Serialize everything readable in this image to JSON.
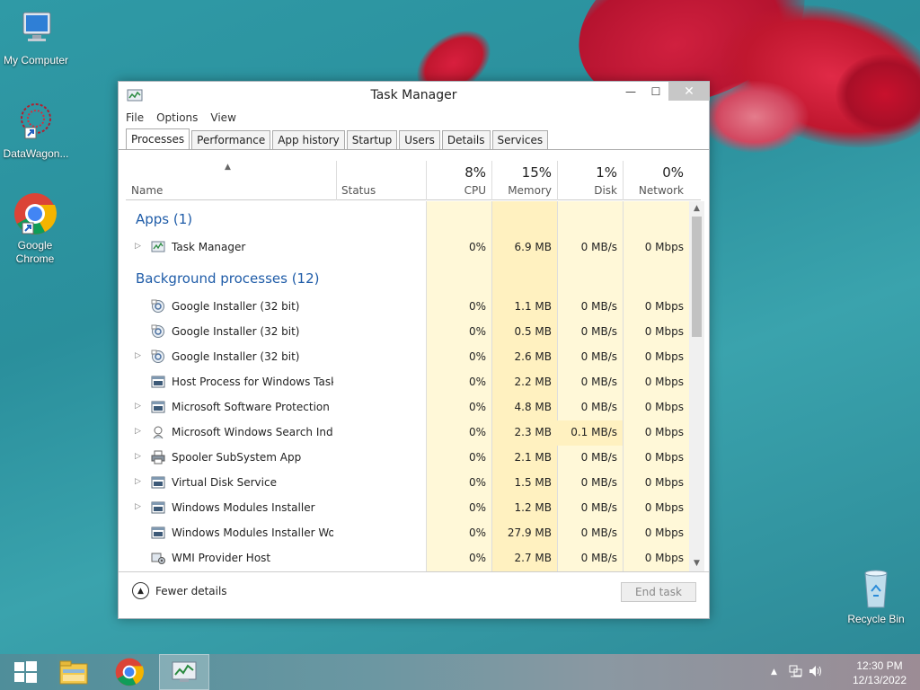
{
  "desktop": {
    "icons": [
      {
        "label": "My Computer"
      },
      {
        "label": "DataWagon..."
      },
      {
        "label": "Google Chrome"
      },
      {
        "label": "Recycle Bin"
      }
    ]
  },
  "window": {
    "title": "Task Manager",
    "controls": {
      "minimize": "—",
      "maximize": "☐",
      "close": "✕"
    },
    "menu": [
      "File",
      "Options",
      "View"
    ],
    "tabs": [
      "Processes",
      "Performance",
      "App history",
      "Startup",
      "Users",
      "Details",
      "Services"
    ],
    "active_tab": "Processes",
    "columns": {
      "name": "Name",
      "status": "Status",
      "cpu": {
        "pct": "8%",
        "label": "CPU"
      },
      "memory": {
        "pct": "15%",
        "label": "Memory"
      },
      "disk": {
        "pct": "1%",
        "label": "Disk"
      },
      "network": {
        "pct": "0%",
        "label": "Network"
      }
    },
    "groups": {
      "apps": "Apps (1)",
      "background": "Background processes (12)"
    },
    "apps": [
      {
        "name": "Task Manager",
        "cpu": "0%",
        "memory": "6.9 MB",
        "disk": "0 MB/s",
        "network": "0 Mbps",
        "expandable": true,
        "icon": "task-manager-icon"
      }
    ],
    "background": [
      {
        "name": "Google Installer (32 bit)",
        "cpu": "0%",
        "memory": "1.1 MB",
        "disk": "0 MB/s",
        "network": "0 Mbps",
        "expandable": false,
        "icon": "google-installer-icon"
      },
      {
        "name": "Google Installer (32 bit)",
        "cpu": "0%",
        "memory": "0.5 MB",
        "disk": "0 MB/s",
        "network": "0 Mbps",
        "expandable": false,
        "icon": "google-installer-icon"
      },
      {
        "name": "Google Installer (32 bit)",
        "cpu": "0%",
        "memory": "2.6 MB",
        "disk": "0 MB/s",
        "network": "0 Mbps",
        "expandable": true,
        "icon": "google-installer-icon"
      },
      {
        "name": "Host Process for Windows Tasks",
        "cpu": "0%",
        "memory": "2.2 MB",
        "disk": "0 MB/s",
        "network": "0 Mbps",
        "expandable": false,
        "icon": "process-icon"
      },
      {
        "name": "Microsoft Software Protection P...",
        "cpu": "0%",
        "memory": "4.8 MB",
        "disk": "0 MB/s",
        "network": "0 Mbps",
        "expandable": true,
        "icon": "process-icon"
      },
      {
        "name": "Microsoft Windows Search Inde...",
        "cpu": "0%",
        "memory": "2.3 MB",
        "disk": "0.1 MB/s",
        "network": "0 Mbps",
        "expandable": true,
        "icon": "search-indexer-icon"
      },
      {
        "name": "Spooler SubSystem App",
        "cpu": "0%",
        "memory": "2.1 MB",
        "disk": "0 MB/s",
        "network": "0 Mbps",
        "expandable": true,
        "icon": "printer-icon"
      },
      {
        "name": "Virtual Disk Service",
        "cpu": "0%",
        "memory": "1.5 MB",
        "disk": "0 MB/s",
        "network": "0 Mbps",
        "expandable": true,
        "icon": "process-icon"
      },
      {
        "name": "Windows Modules Installer",
        "cpu": "0%",
        "memory": "1.2 MB",
        "disk": "0 MB/s",
        "network": "0 Mbps",
        "expandable": true,
        "icon": "process-icon"
      },
      {
        "name": "Windows Modules Installer Wor...",
        "cpu": "0%",
        "memory": "27.9 MB",
        "disk": "0 MB/s",
        "network": "0 Mbps",
        "expandable": false,
        "icon": "process-icon"
      },
      {
        "name": "WMI Provider Host",
        "cpu": "0%",
        "memory": "2.7 MB",
        "disk": "0 MB/s",
        "network": "0 Mbps",
        "expandable": false,
        "icon": "wmi-icon"
      }
    ],
    "footer": {
      "fewer_details": "Fewer details",
      "end_task": "End task"
    }
  },
  "taskbar": {
    "clock_time": "12:30 PM",
    "clock_date": "12/13/2022"
  },
  "colors": {
    "group_heading": "#1f5ca8",
    "cpu_column_bg": "#fff8d8",
    "memory_column_bg": "#fff1c0",
    "disk_highlight_bg": "#fff1c0"
  }
}
